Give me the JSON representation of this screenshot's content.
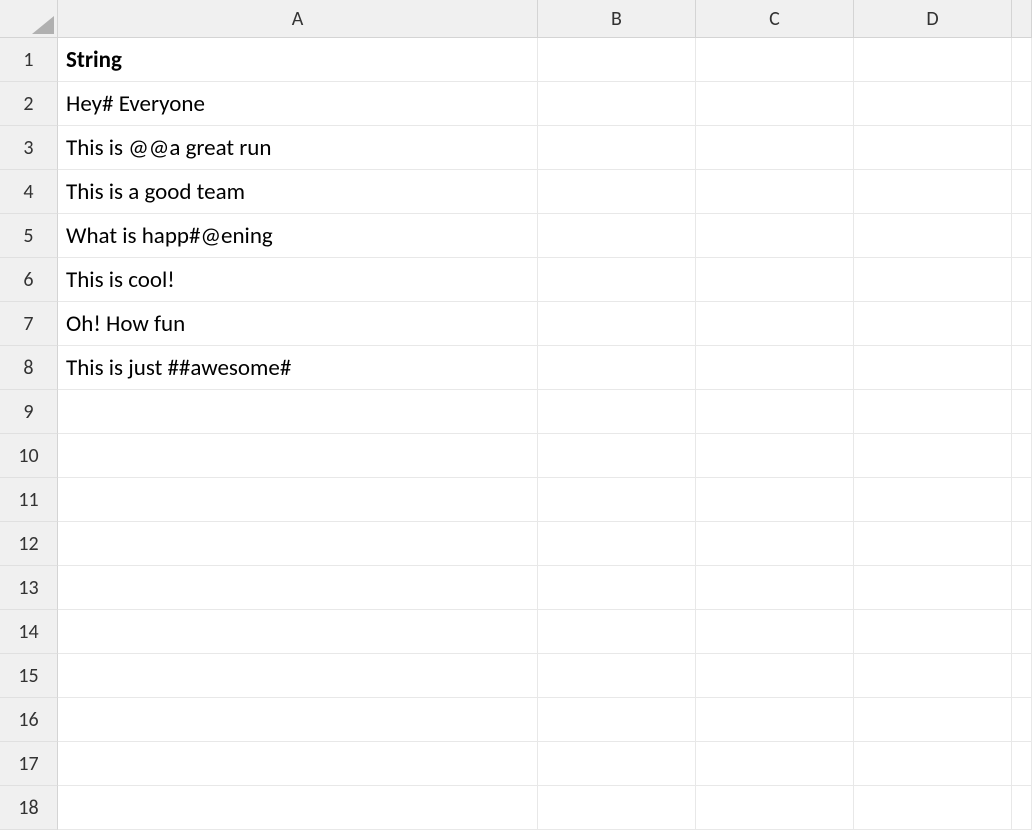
{
  "columns": [
    "A",
    "B",
    "C",
    "D",
    ""
  ],
  "rows": [
    "1",
    "2",
    "3",
    "4",
    "5",
    "6",
    "7",
    "8",
    "9",
    "10",
    "11",
    "12",
    "13",
    "14",
    "15",
    "16",
    "17",
    "18"
  ],
  "cells": {
    "A1": {
      "value": "String",
      "bold": true
    },
    "A2": {
      "value": "Hey# Everyone"
    },
    "A3": {
      "value": "This is @@a great run"
    },
    "A4": {
      "value": "This is a good team"
    },
    "A5": {
      "value": "What is happ#@ening"
    },
    "A6": {
      "value": "This is cool!"
    },
    "A7": {
      "value": "Oh! How fun"
    },
    "A8": {
      "value": "This is just ##awesome#"
    }
  }
}
